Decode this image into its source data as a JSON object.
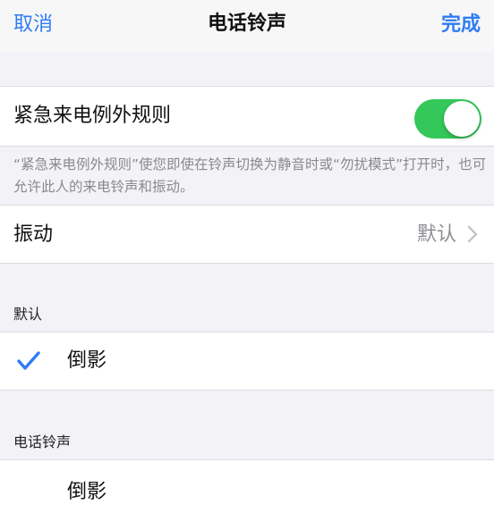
{
  "nav": {
    "cancel": "取消",
    "title": "电话铃声",
    "done": "完成"
  },
  "emergency": {
    "label": "紧急来电例外规则",
    "enabled": true,
    "footnote": "“紧急来电例外规则”使您即使在铃声切换为静音时或“勿扰模式”打开时，也可允许此人的来电铃声和振动。"
  },
  "vibration": {
    "label": "振动",
    "value": "默认"
  },
  "sections": {
    "default_header": "默认",
    "default_item": "倒影",
    "ringtones_header": "电话铃声",
    "ringtone_item": "倒影"
  },
  "colors": {
    "accent": "#2f7cf6",
    "toggle_on": "#34c759"
  },
  "icons": {
    "chevron": "chevron-right-icon",
    "check": "checkmark-icon"
  }
}
